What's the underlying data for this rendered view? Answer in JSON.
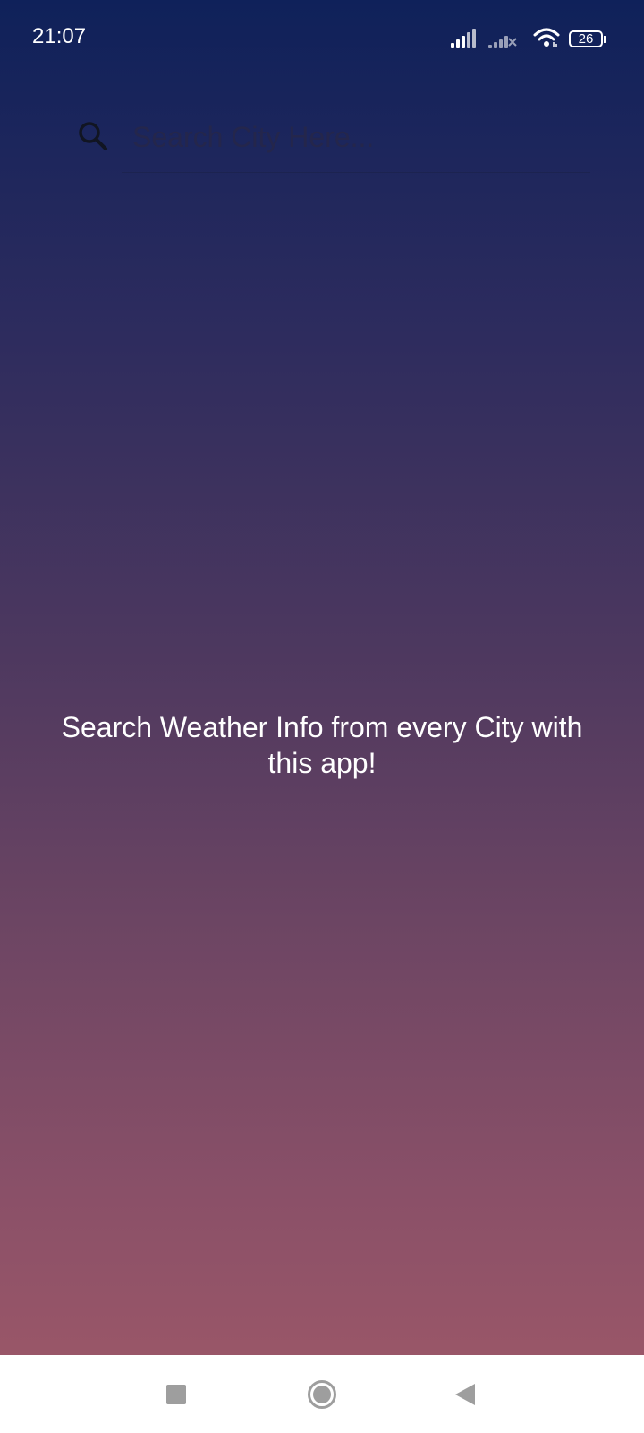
{
  "status_bar": {
    "time": "21:07",
    "battery_level": "26",
    "icons": [
      "signal-icon",
      "signal-no-service-icon",
      "wifi-icon",
      "battery-icon"
    ]
  },
  "search": {
    "placeholder": "Search City Here...",
    "value": "",
    "icon": "search-icon"
  },
  "main": {
    "message": "Search Weather Info from every City with this app!"
  },
  "nav_bar": {
    "icons": [
      "recents-square-icon",
      "home-circle-icon",
      "back-triangle-icon"
    ]
  },
  "colors": {
    "gradient_top": "#0f215a",
    "gradient_bottom": "#995668",
    "text": "#ffffff",
    "nav_background": "#ffffff",
    "nav_icon": "#9e9e9e"
  }
}
